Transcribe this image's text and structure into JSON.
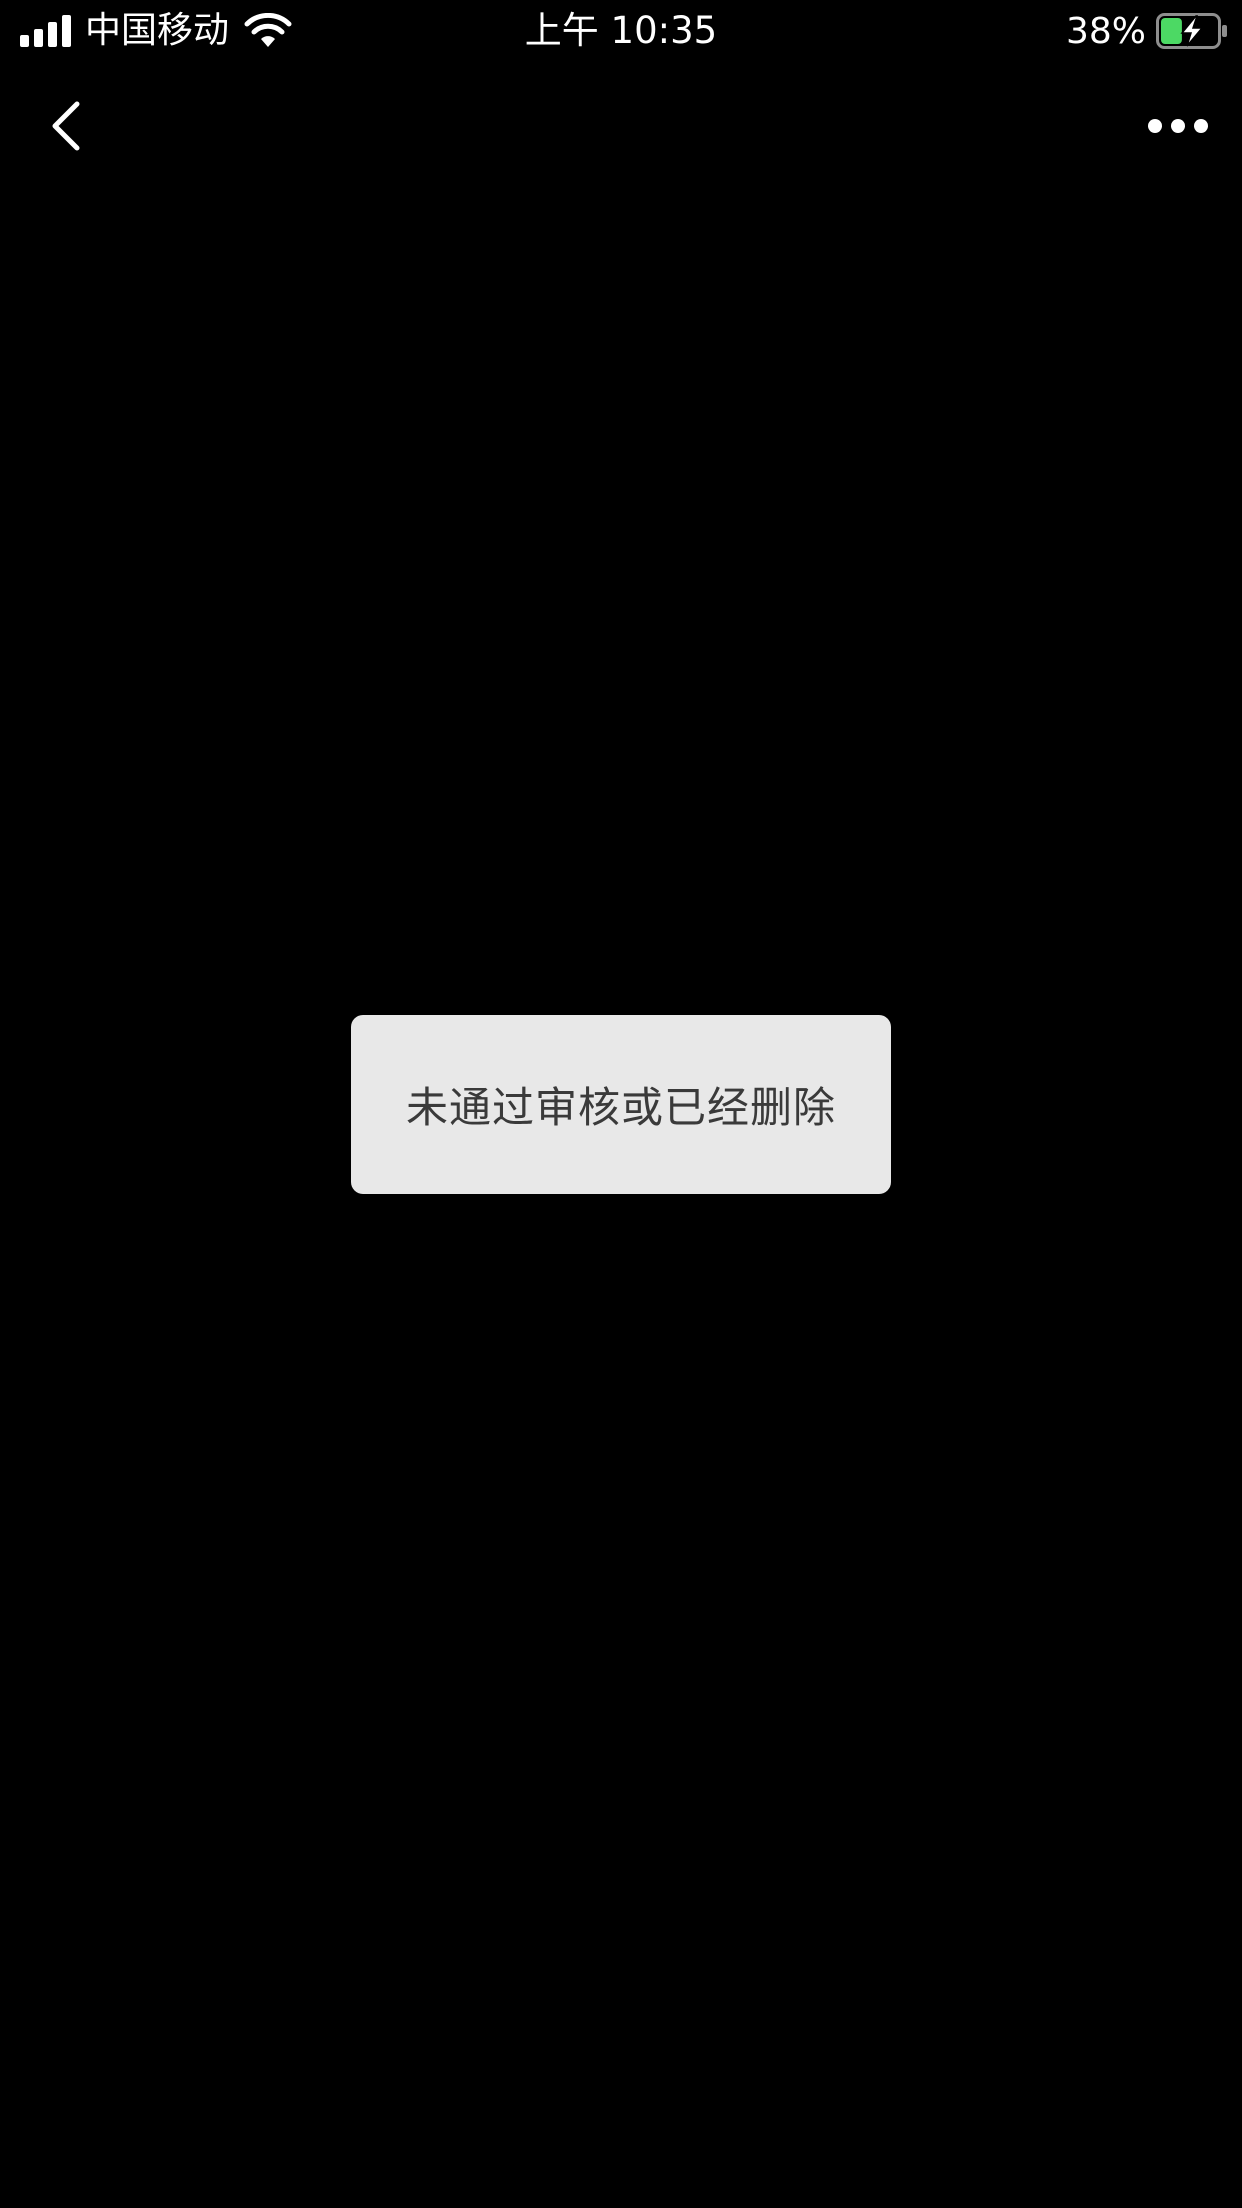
{
  "status_bar": {
    "carrier": "中国移动",
    "time": "上午 10:35",
    "battery_percent": "38%",
    "battery_level": 0.38,
    "battery_charging": true,
    "signal_icon": "cellular-signal-icon",
    "wifi_icon": "wifi-icon",
    "battery_icon": "battery-charging-icon"
  },
  "nav_bar": {
    "back_icon": "chevron-left-icon",
    "more_icon": "more-horizontal-icon"
  },
  "toast": {
    "message": "未通过审核或已经删除"
  },
  "colors": {
    "background": "#000000",
    "foreground": "#ffffff",
    "toast_background": "#e8e8e8",
    "toast_text": "#3a3a3a",
    "battery_fill": "#4cd964"
  }
}
